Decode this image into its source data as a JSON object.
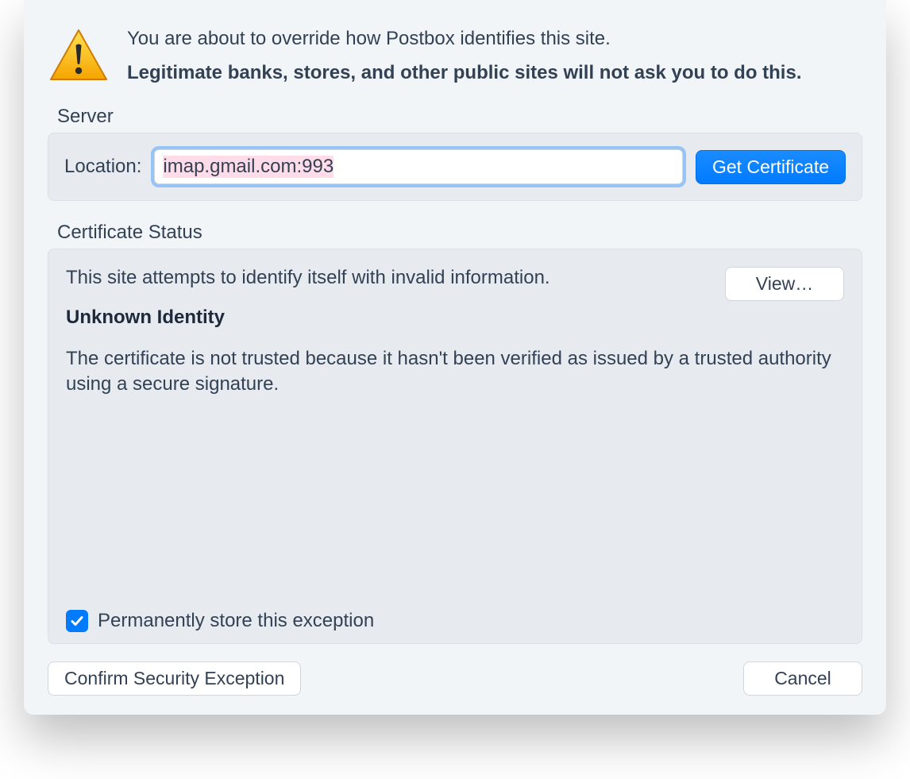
{
  "header": {
    "line1": "You are about to override how Postbox identifies this site.",
    "line2": "Legitimate banks, stores, and other public sites will not ask you to do this."
  },
  "server": {
    "group_label": "Server",
    "location_label": "Location:",
    "location_value": "imap.gmail.com:993",
    "get_cert_button": "Get Certificate"
  },
  "certificate_status": {
    "group_label": "Certificate Status",
    "view_button": "View…",
    "intro": "This site attempts to identify itself with invalid information.",
    "identity_title": "Unknown Identity",
    "description": "The certificate is not trusted because it hasn't been verified as issued by a trusted authority using a secure signature.",
    "permanent_checkbox_label": "Permanently store this exception",
    "permanent_checked": true
  },
  "footer": {
    "confirm_button": "Confirm Security Exception",
    "cancel_button": "Cancel"
  }
}
